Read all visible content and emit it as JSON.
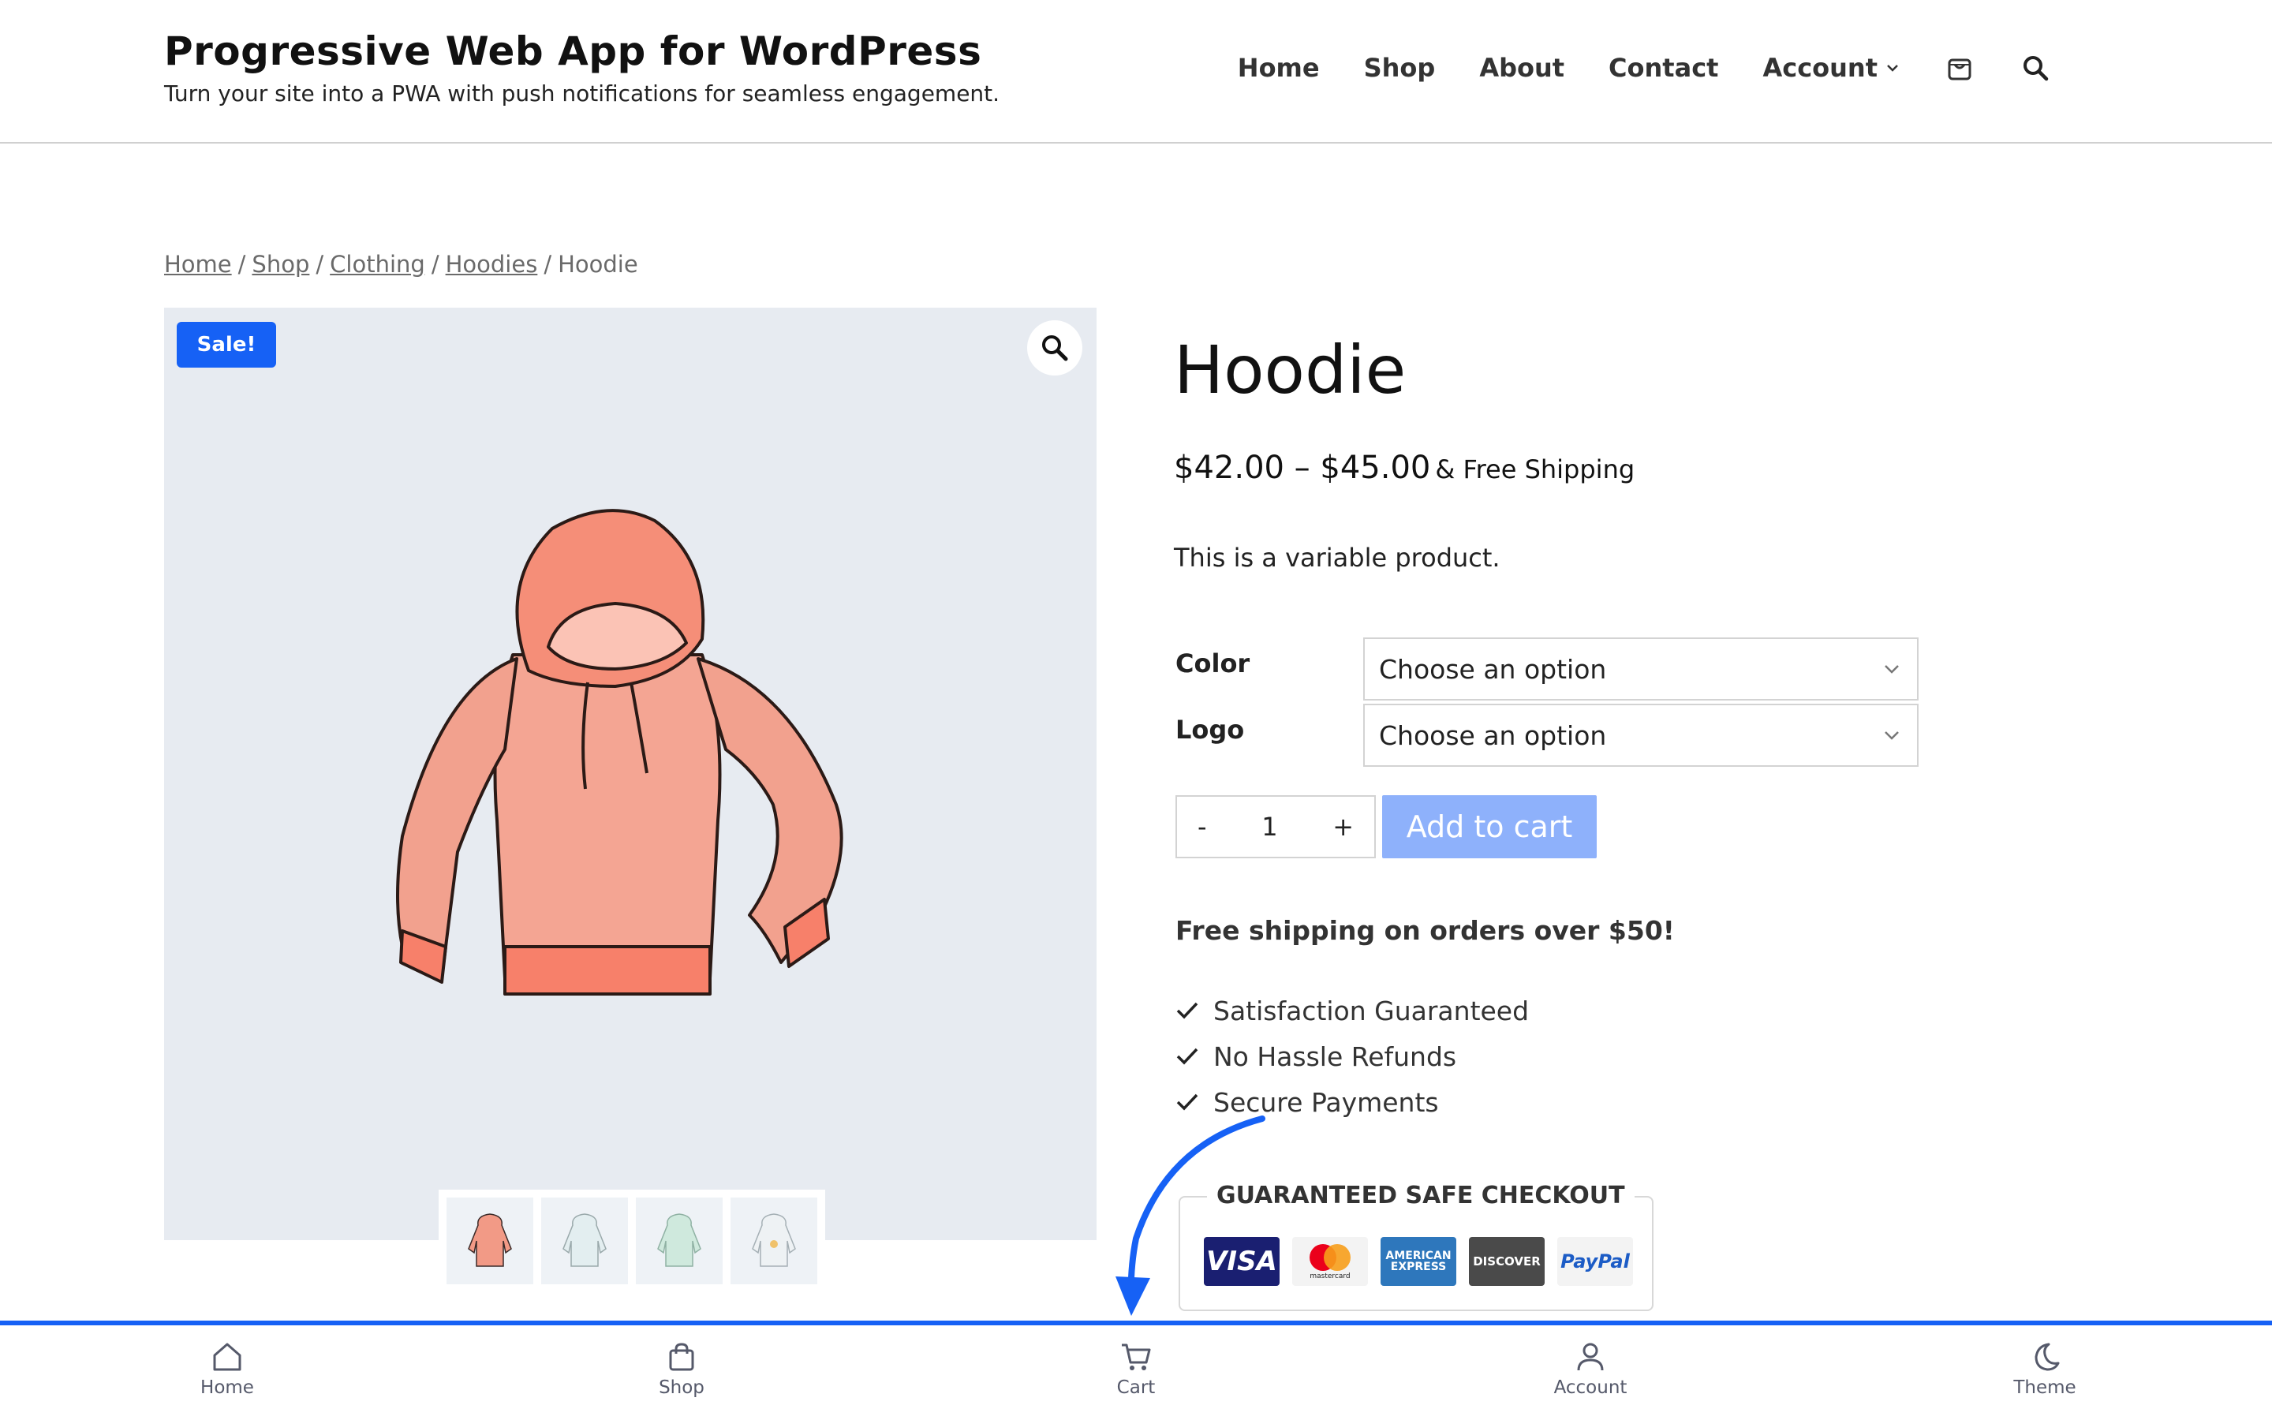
{
  "header": {
    "site_title": "Progressive Web App for WordPress",
    "tagline": "Turn your site into a PWA with push notifications for seamless engagement.",
    "nav": [
      "Home",
      "Shop",
      "About",
      "Contact",
      "Account"
    ],
    "icons": [
      "cart-icon",
      "search-icon"
    ]
  },
  "breadcrumb": {
    "items": [
      "Home",
      "Shop",
      "Clothing",
      "Hoodies"
    ],
    "current": "Hoodie",
    "separator": "/"
  },
  "gallery": {
    "badge": "Sale!",
    "zoom_icon": "magnifier-icon",
    "thumbnail_count": 4
  },
  "product": {
    "title": "Hoodie",
    "price": "$42.00 – $45.00",
    "price_suffix": "& Free Shipping",
    "description": "This is a variable product.",
    "variations": [
      {
        "label": "Color",
        "value": "Choose an option"
      },
      {
        "label": "Logo",
        "value": "Choose an option"
      }
    ],
    "quantity": "1",
    "qty_minus": "-",
    "qty_plus": "+",
    "add_to_cart": "Add to cart",
    "free_shipping_note": "Free shipping on orders over $50!",
    "features": [
      "Satisfaction Guaranteed",
      "No Hassle Refunds",
      "Secure Payments"
    ]
  },
  "safe_checkout": {
    "title": "GUARANTEED SAFE CHECKOUT",
    "cards": [
      "VISA",
      "mastercard",
      "AMERICAN EXPRESS",
      "DISCOVER",
      "PayPal"
    ]
  },
  "bottom_nav": [
    "Home",
    "Shop",
    "Cart",
    "Account",
    "Theme"
  ],
  "colors": {
    "accent": "#1661f5",
    "add_to_cart": "#8eb1fb",
    "gallery_bg": "#e7ebf1"
  }
}
